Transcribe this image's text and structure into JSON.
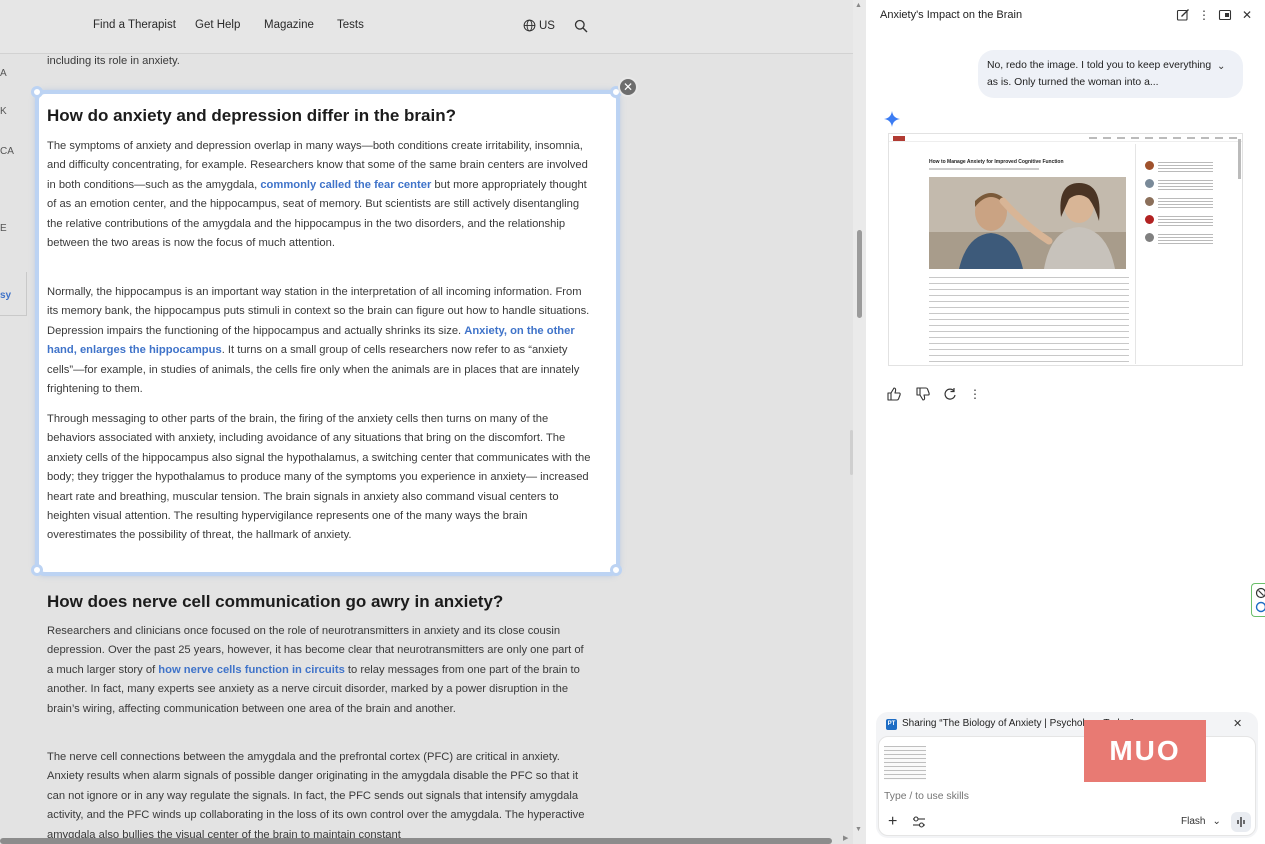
{
  "nav": {
    "links": [
      "Find a Therapist",
      "Get Help",
      "Magazine",
      "Tests"
    ],
    "region": "US"
  },
  "left_edge": [
    "A",
    "K",
    "CA",
    "E",
    "sy"
  ],
  "article": {
    "prev_line": "including its role in anxiety.",
    "card": {
      "title": "How do anxiety and depression differ in the brain?",
      "p1_a": "The symptoms of anxiety and depression overlap in many ways—both conditions create irritability, insomnia, and difficulty concentrating, for example. Researchers know that some of the same brain centers are involved in both conditions—such as the amygdala, ",
      "p1_link": "commonly called the fear center",
      "p1_b": " but more appropriately thought of as an emotion center, and the hippocampus, seat of memory. But scientists are still actively disentangling the relative contributions of the amygdala and the hippocampus in the two disorders, and the relationship between the two areas is now the focus of much attention.",
      "p2_a": "Normally, the hippocampus is an important way station in the interpretation of all incoming information. From its memory bank, the hippocampus puts stimuli in context so the brain can figure out how to handle situations. Depression impairs the functioning of the hippocampus and actually shrinks its size. ",
      "p2_link": "Anxiety, on the other hand, enlarges the hippocampus",
      "p2_b": ". It turns on a small group of cells researchers now refer to as “anxiety cells”—for example, in studies of animals, the cells fire only when the animals are in places that are innately frightening to them.",
      "p3": "Through messaging to other parts of the brain, the firing of the anxiety cells then turns on many of the behaviors associated with anxiety, including avoidance of any situations that bring on the discomfort. The anxiety cells of the hippocampus also signal the hypothalamus, a switching center that communicates with the body; they trigger the hypothalamus to produce many of the symptoms you experience in anxiety— increased heart rate and breathing, muscular tension. The brain signals in anxiety also command visual centers to heighten visual attention. The resulting hypervigilance represents one of the many ways the brain overestimates the possibility of threat, the hallmark of anxiety."
    },
    "section2": {
      "title": "How does nerve cell communication go awry in anxiety?",
      "p1_a": "Researchers and clinicians once focused on the role of neurotransmitters in anxiety and its close cousin depression. Over the past 25 years, however, it has become clear that neurotransmitters are only one part of a much larger story of ",
      "p1_link": "how nerve cells function in circuits",
      "p1_b": " to relay messages from one part of the brain to another. In fact, many experts see anxiety as a nerve circuit disorder, marked by a power disruption in the brain’s wiring, affecting communication between one area of the brain and another.",
      "p2": "The nerve cell connections between the amygdala and the prefrontal cortex (PFC) are critical in anxiety. Anxiety results when alarm signals of possible danger originating in the amygdala disable the PFC so that it can not ignore or in any way regulate the signals. In fact, the PFC sends out signals that intensify amygdala activity, and the PFC winds up collaborating in the loss of its own control over the amygdala. The hyperactive amygdala also bullies the visual center of the brain to maintain constant"
    }
  },
  "panel": {
    "title": "Anxiety's Impact on the Brain",
    "user_message": "No, redo the image. I told you to keep everything as is. Only turned the woman into a...",
    "generated_image": {
      "heading": "How to Manage Anxiety for Improved Cognitive Function",
      "sidebar_dot_colors": [
        "#a0522d",
        "#7a8a99",
        "#8b6f5a",
        "#b22222",
        "#808080"
      ]
    },
    "share": {
      "badge": "PT",
      "label": "Sharing “The Biology of Anxiety | Psychology Today”"
    },
    "input_placeholder": "Type / to use skills",
    "model": "Flash",
    "watermark": "MUO"
  },
  "colors": {
    "accent_link": "#3f73c9",
    "card_border": "#bcd3f3",
    "sparkle": "#3b7cf3",
    "watermark": "#e87a73"
  }
}
